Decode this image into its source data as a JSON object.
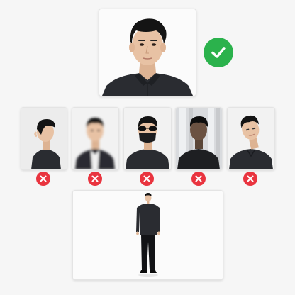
{
  "colors": {
    "background": "#f6f6f6",
    "card": "#ffffff",
    "approved": "#2bb24c",
    "rejected": "#e9343f",
    "shirt": "#2a2c31",
    "skin": "#e8c2a4",
    "hair": "#141414"
  },
  "main_photo": {
    "status": "approved",
    "status_icon": "checkmark-icon"
  },
  "rejected_examples": [
    {
      "id": "side-profile",
      "status": "rejected",
      "status_icon": "cross-icon"
    },
    {
      "id": "blurry",
      "status": "rejected",
      "status_icon": "cross-icon"
    },
    {
      "id": "sunglasses-and-mask",
      "status": "rejected",
      "status_icon": "cross-icon"
    },
    {
      "id": "backlit-dark",
      "status": "rejected",
      "status_icon": "cross-icon"
    },
    {
      "id": "tilted-head",
      "status": "rejected",
      "status_icon": "cross-icon"
    }
  ],
  "full_body_photo": {
    "description_icon": "full-body-person-icon"
  }
}
